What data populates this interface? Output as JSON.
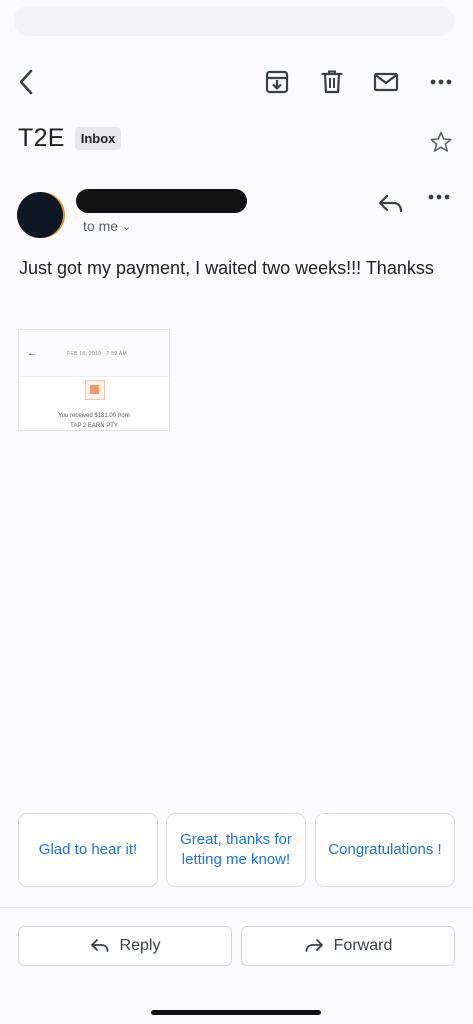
{
  "toolbar": {
    "back_icon": "chevron-left-icon",
    "archive_icon": "archive-icon",
    "delete_icon": "trash-icon",
    "mark_unread_icon": "mail-icon",
    "more_icon": "more-horizontal-icon"
  },
  "subject": {
    "title": "T2E",
    "label": "Inbox",
    "star_icon": "star-outline-icon"
  },
  "message": {
    "sender_name": "",
    "recipient_text": "to me",
    "recipient_chevron": "⌄",
    "body": "Just got my payment, I waited two weeks!!! Thankss",
    "reply_icon": "reply-icon",
    "more_icon": "more-horizontal-icon",
    "attachment": {
      "date_text": "FEB 16, 2019 · 7:59 AM",
      "text_line1": "You received $181.00 from",
      "text_line2": "TAP 2 EARN PTY"
    }
  },
  "smart_replies": [
    {
      "label": "Glad to hear it!"
    },
    {
      "label": "Great, thanks for letting me know!"
    },
    {
      "label": "Congratulations !"
    }
  ],
  "actions": {
    "reply_label": "Reply",
    "forward_label": "Forward"
  },
  "colors": {
    "accent": "#1a73e8",
    "background": "#fbfbfd",
    "text": "#202124"
  }
}
